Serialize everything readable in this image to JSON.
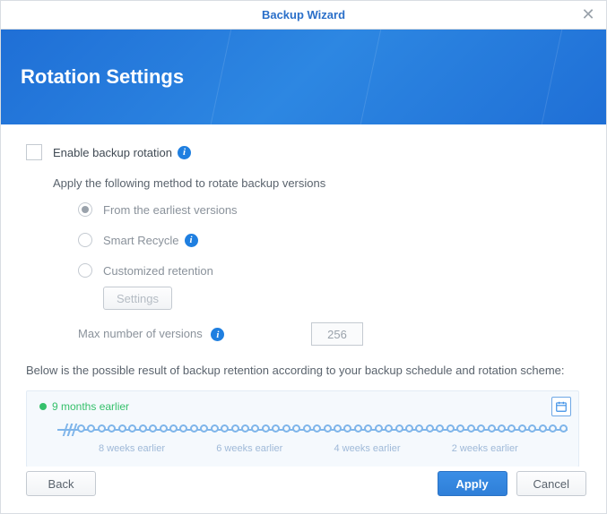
{
  "titlebar": {
    "title": "Backup Wizard"
  },
  "banner": {
    "heading": "Rotation Settings"
  },
  "form": {
    "enable_label": "Enable backup rotation",
    "apply_text": "Apply the following method to rotate backup versions",
    "radios": {
      "earliest": "From the earliest versions",
      "smart": "Smart Recycle",
      "custom": "Customized retention"
    },
    "settings_btn": "Settings",
    "max_label": "Max number of versions",
    "max_value": "256",
    "explain": "Below is the possible result of backup retention according to your backup schedule and rotation scheme:"
  },
  "timeline": {
    "earliest": "9 months earlier",
    "labels": [
      "8 weeks earlier",
      "6 weeks earlier",
      "4 weeks earlier",
      "2 weeks earlier"
    ]
  },
  "footer": {
    "back": "Back",
    "apply": "Apply",
    "cancel": "Cancel"
  }
}
